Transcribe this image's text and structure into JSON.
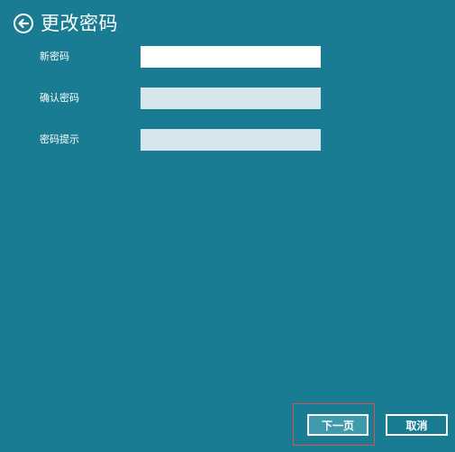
{
  "header": {
    "title": "更改密码",
    "back_icon": "back-arrow-circle-icon"
  },
  "form": {
    "fields": [
      {
        "label": "新密码",
        "value": "",
        "state": "active"
      },
      {
        "label": "确认密码",
        "value": "",
        "state": "disabled"
      },
      {
        "label": "密码提示",
        "value": "",
        "state": "disabled"
      }
    ]
  },
  "footer": {
    "next_label": "下一页",
    "cancel_label": "取消"
  },
  "colors": {
    "background": "#1a7c92",
    "active_input": "#ffffff",
    "disabled_input": "#d4e5ec",
    "highlight_border": "#d9534f",
    "next_button_bg": "#3f9aae"
  }
}
